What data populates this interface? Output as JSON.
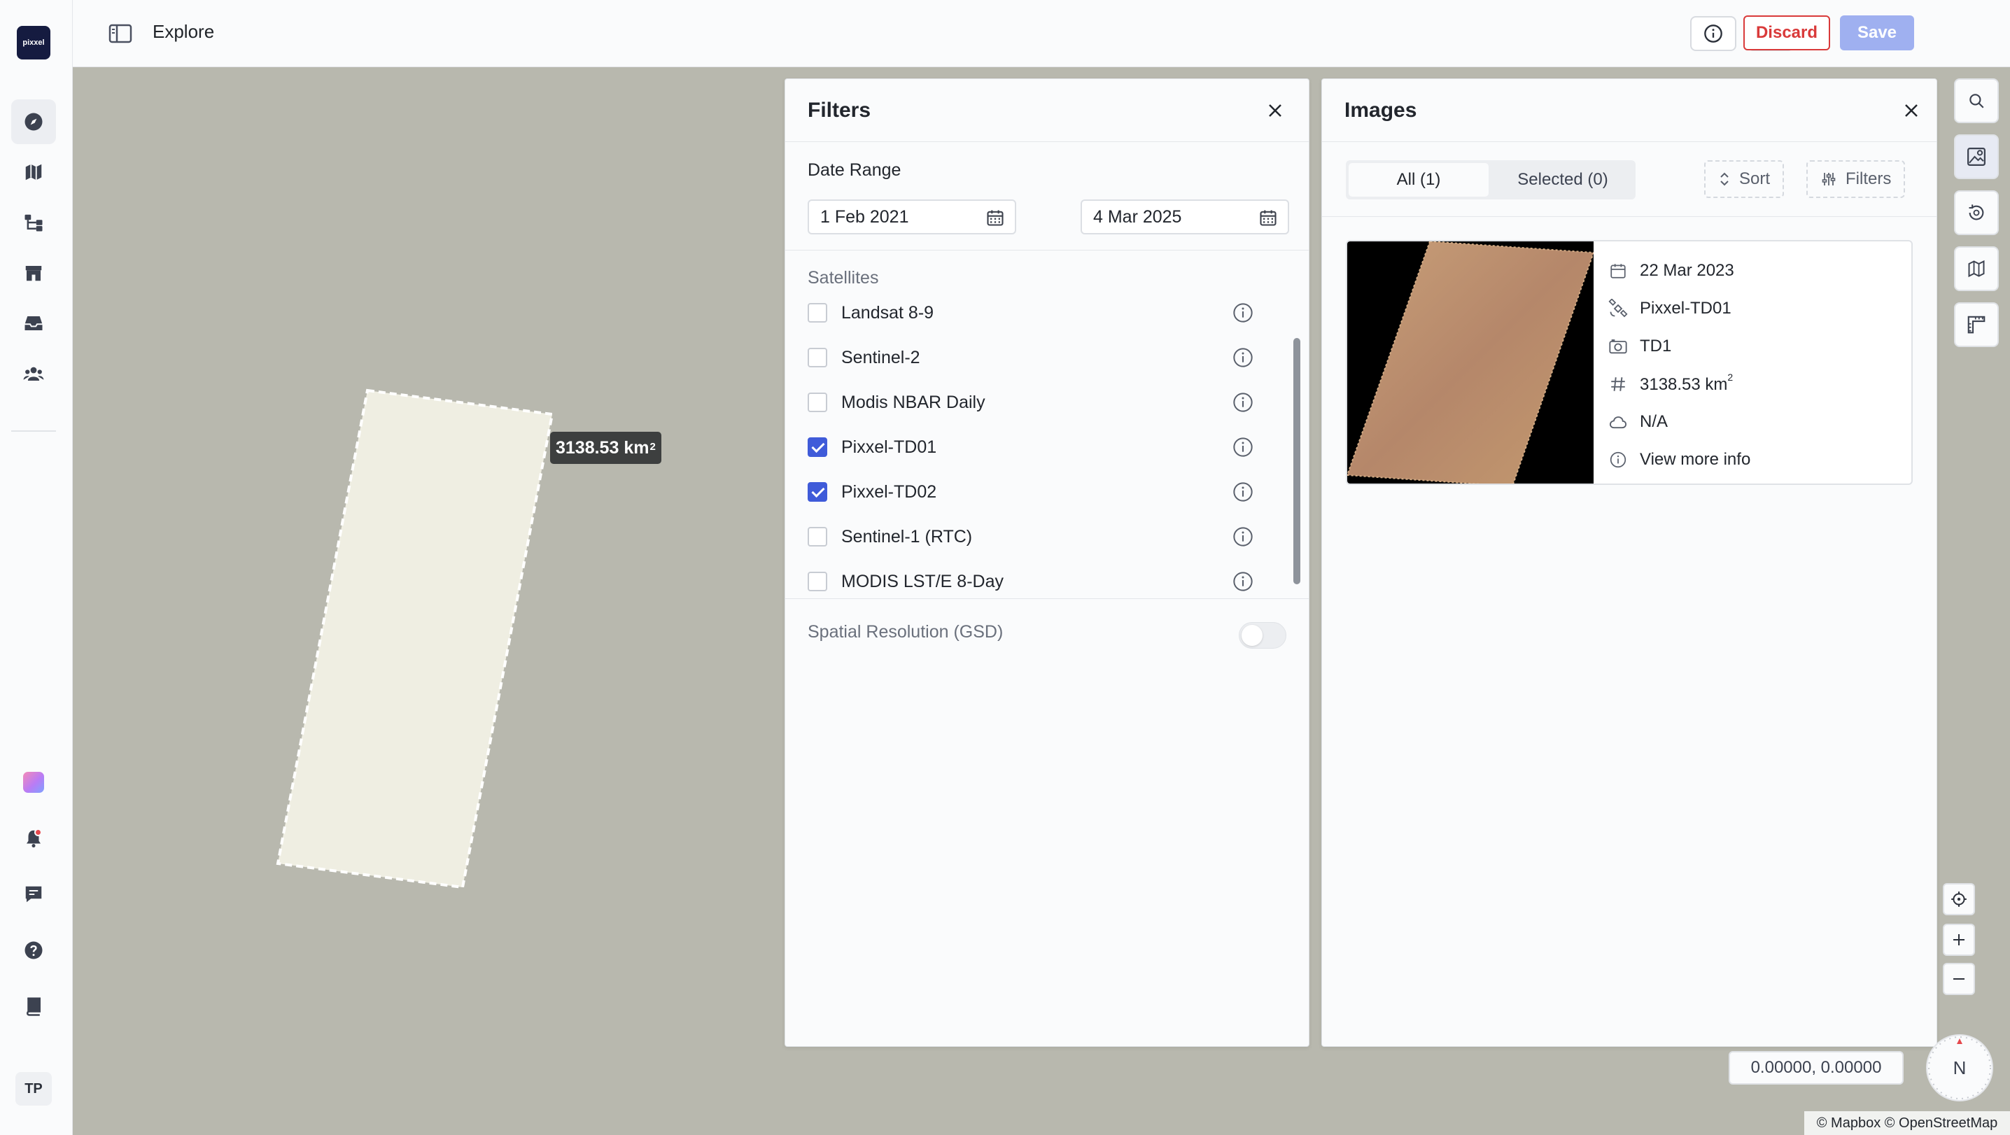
{
  "app": {
    "logo_text": "pixxel",
    "page_title": "Explore",
    "avatar_initials": "TP",
    "sidebar_icons": [
      "compass-icon",
      "map-icon",
      "workflow-icon",
      "storefront-icon",
      "inbox-icon",
      "team-icon",
      "apps-icon",
      "bell-icon",
      "feedback-icon",
      "help-icon",
      "docs-icon"
    ],
    "notification_badge_color": "#e5484d"
  },
  "toolbar": {
    "discard_label": "Discard",
    "save_label": "Save",
    "discard_color": "#d93a3a",
    "save_color": "#9fb0f0"
  },
  "map": {
    "area_value": "3138.53 km",
    "area_unit_sup": "2",
    "coordinates": "0.00000, 0.00000",
    "compass_label": "N",
    "attribution": "© Mapbox © OpenStreetMap"
  },
  "filters": {
    "title": "Filters",
    "date_range_label": "Date Range",
    "start_date": "1 Feb 2021",
    "end_date": "4 Mar 2025",
    "satellites_label": "Satellites",
    "satellites": [
      {
        "name": "Landsat 8-9",
        "checked": false
      },
      {
        "name": "Sentinel-2",
        "checked": false
      },
      {
        "name": "Modis NBAR Daily",
        "checked": false
      },
      {
        "name": "Pixxel-TD01",
        "checked": true
      },
      {
        "name": "Pixxel-TD02",
        "checked": true
      },
      {
        "name": "Sentinel-1 (RTC)",
        "checked": false
      },
      {
        "name": "MODIS LST/E 8-Day",
        "checked": false
      }
    ],
    "gsd_label": "Spatial Resolution (GSD)",
    "gsd_enabled": false,
    "accent_color": "#3f5bd9"
  },
  "images": {
    "title": "Images",
    "tab_all": "All (1)",
    "tab_selected": "Selected (0)",
    "sort_label": "Sort",
    "filters_label": "Filters",
    "card": {
      "date": "22 Mar 2023",
      "satellite": "Pixxel-TD01",
      "sensor": "TD1",
      "area": "3138.53 km",
      "area_sup": "2",
      "cloud": "N/A",
      "more_info": "View more info"
    }
  }
}
